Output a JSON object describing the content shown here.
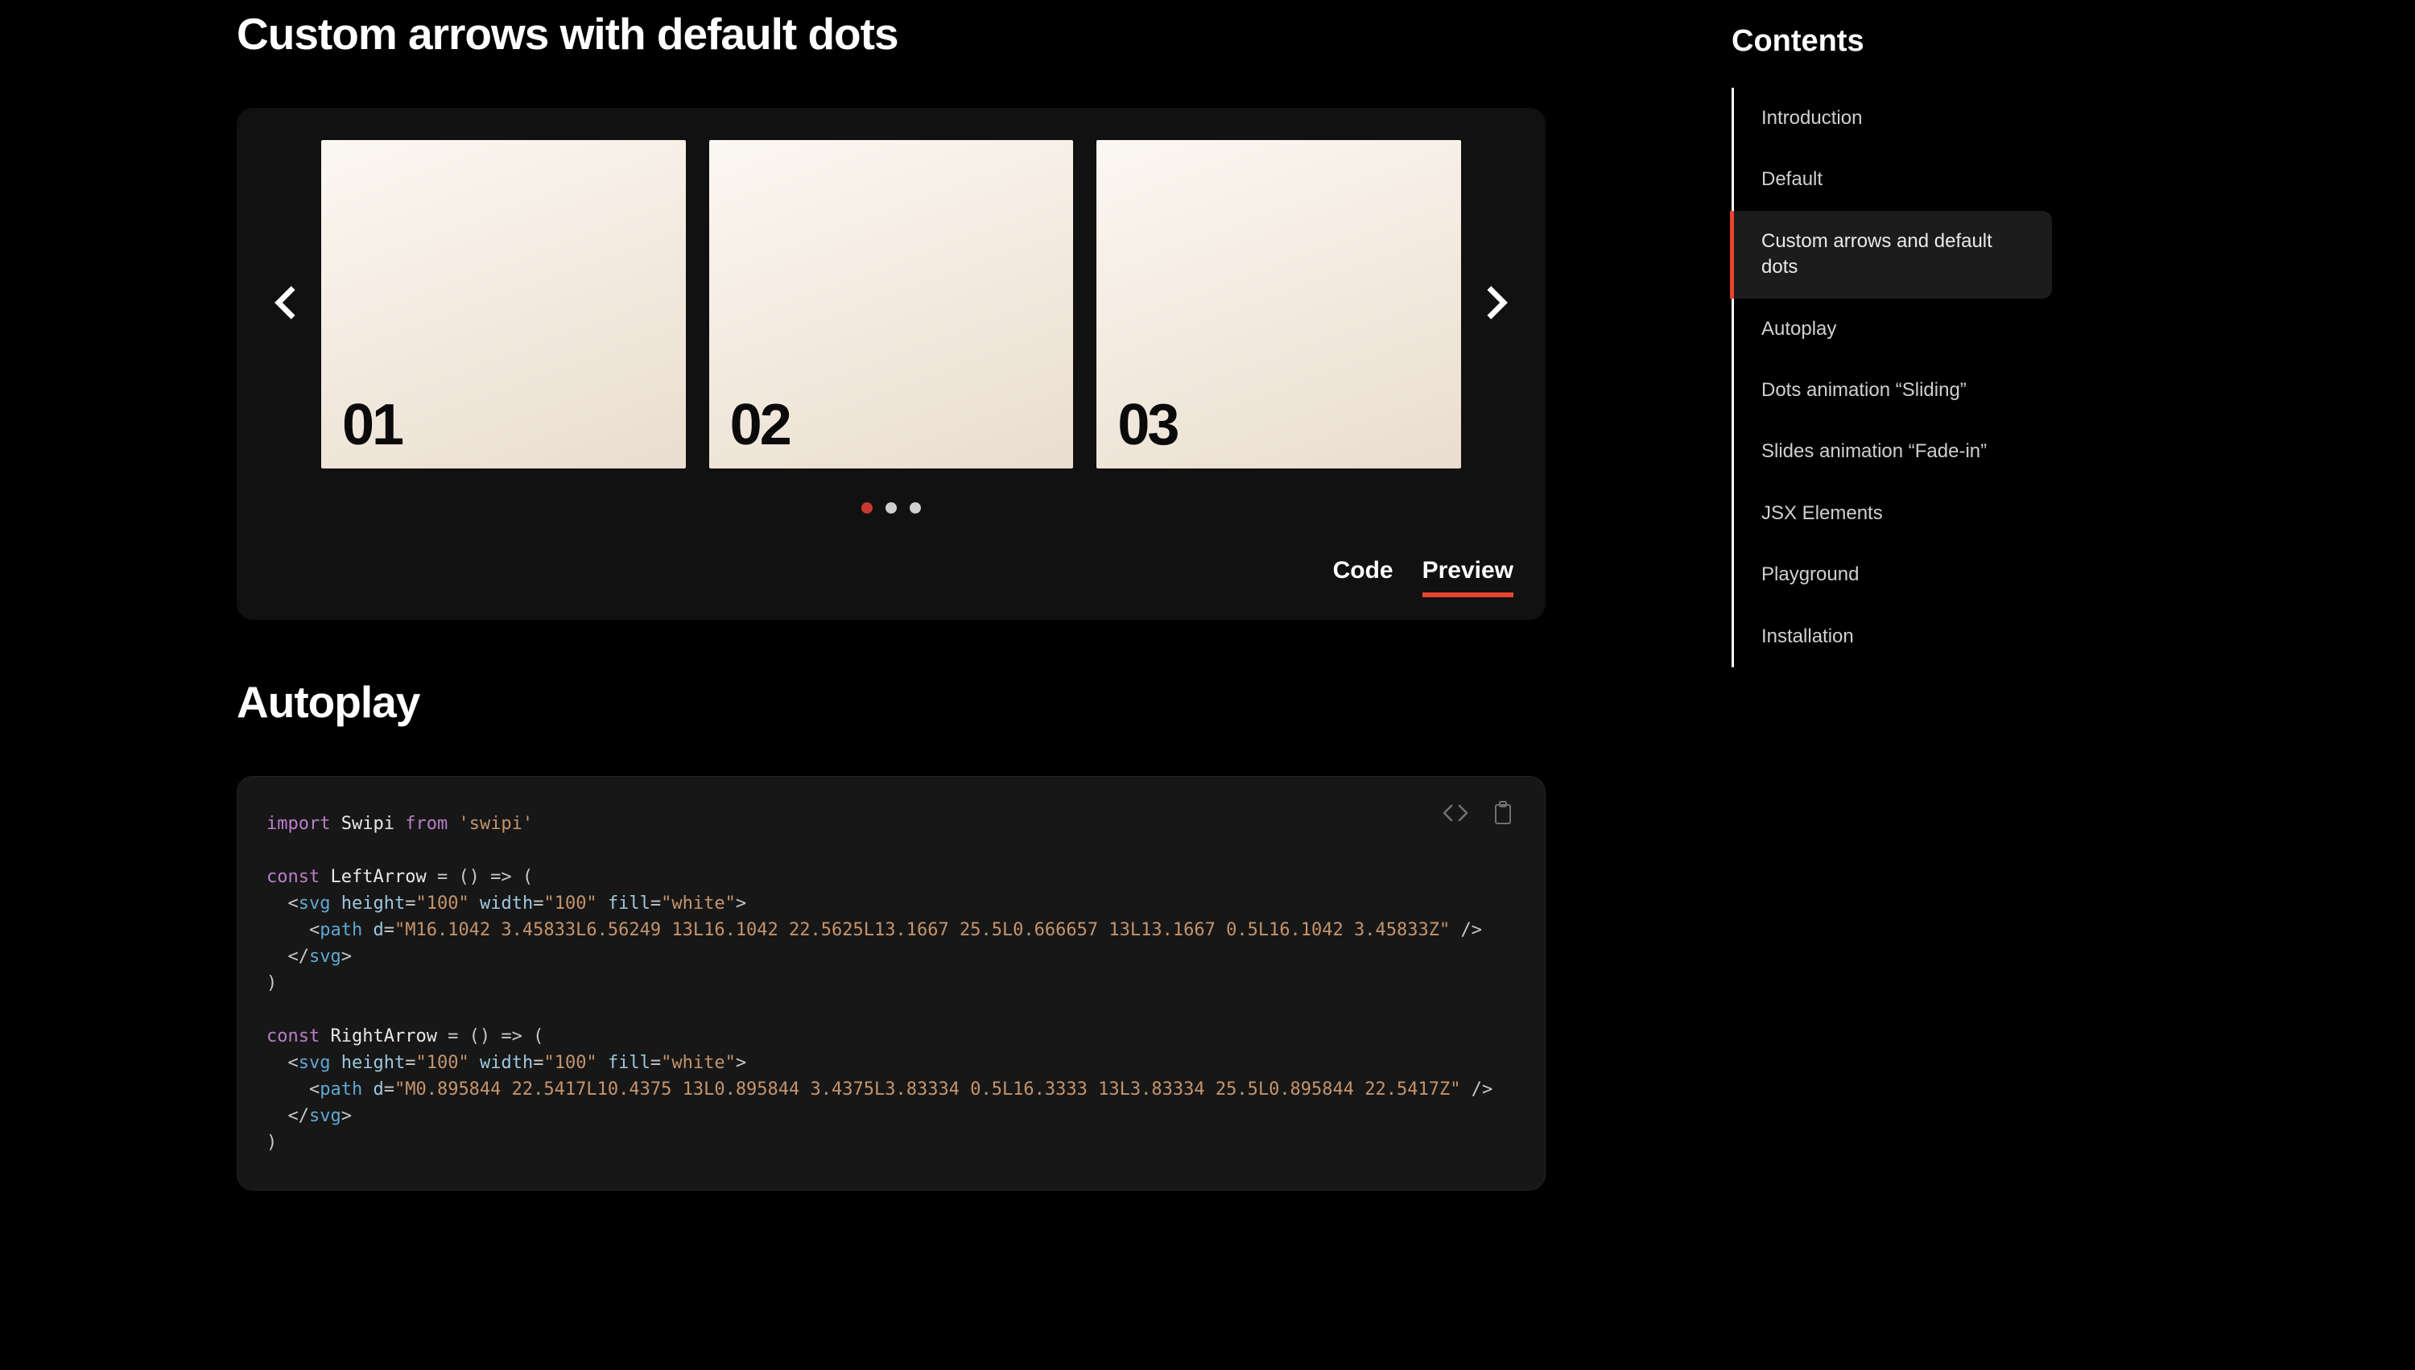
{
  "sections": {
    "custom_arrows": {
      "title": "Custom arrows with default dots",
      "slides": [
        "01",
        "02",
        "03"
      ],
      "active_dot": 0,
      "dot_count": 3,
      "tabs": {
        "code": "Code",
        "preview": "Preview",
        "active": "preview"
      }
    },
    "autoplay": {
      "title": "Autoplay",
      "code_tokens": [
        [
          "kw",
          "import"
        ],
        [
          "pun",
          " "
        ],
        [
          "id",
          "Swipi"
        ],
        [
          "pun",
          " "
        ],
        [
          "kw",
          "from"
        ],
        [
          "pun",
          " "
        ],
        [
          "str",
          "'swipi'"
        ],
        [
          "nl",
          ""
        ],
        [
          "nl",
          ""
        ],
        [
          "kw",
          "const"
        ],
        [
          "pun",
          " "
        ],
        [
          "id",
          "LeftArrow"
        ],
        [
          "pun",
          " = () => ("
        ],
        [
          "nl",
          ""
        ],
        [
          "pun",
          "  <"
        ],
        [
          "tag",
          "svg"
        ],
        [
          "pun",
          " "
        ],
        [
          "attr",
          "height"
        ],
        [
          "pun",
          "="
        ],
        [
          "str",
          "\"100\""
        ],
        [
          "pun",
          " "
        ],
        [
          "attr",
          "width"
        ],
        [
          "pun",
          "="
        ],
        [
          "str",
          "\"100\""
        ],
        [
          "pun",
          " "
        ],
        [
          "attr",
          "fill"
        ],
        [
          "pun",
          "="
        ],
        [
          "str",
          "\"white\""
        ],
        [
          "pun",
          ">"
        ],
        [
          "nl",
          ""
        ],
        [
          "pun",
          "    <"
        ],
        [
          "tag",
          "path"
        ],
        [
          "pun",
          " "
        ],
        [
          "attr",
          "d"
        ],
        [
          "pun",
          "="
        ],
        [
          "str",
          "\"M16.1042 3.45833L6.56249 13L16.1042 22.5625L13.1667 25.5L0.666657 13L13.1667 0.5L16.1042 3.45833Z\""
        ],
        [
          "pun",
          " />"
        ],
        [
          "nl",
          ""
        ],
        [
          "pun",
          "  </"
        ],
        [
          "tag",
          "svg"
        ],
        [
          "pun",
          ">"
        ],
        [
          "nl",
          ""
        ],
        [
          "pun",
          ")"
        ],
        [
          "nl",
          ""
        ],
        [
          "nl",
          ""
        ],
        [
          "kw",
          "const"
        ],
        [
          "pun",
          " "
        ],
        [
          "id",
          "RightArrow"
        ],
        [
          "pun",
          " = () => ("
        ],
        [
          "nl",
          ""
        ],
        [
          "pun",
          "  <"
        ],
        [
          "tag",
          "svg"
        ],
        [
          "pun",
          " "
        ],
        [
          "attr",
          "height"
        ],
        [
          "pun",
          "="
        ],
        [
          "str",
          "\"100\""
        ],
        [
          "pun",
          " "
        ],
        [
          "attr",
          "width"
        ],
        [
          "pun",
          "="
        ],
        [
          "str",
          "\"100\""
        ],
        [
          "pun",
          " "
        ],
        [
          "attr",
          "fill"
        ],
        [
          "pun",
          "="
        ],
        [
          "str",
          "\"white\""
        ],
        [
          "pun",
          ">"
        ],
        [
          "nl",
          ""
        ],
        [
          "pun",
          "    <"
        ],
        [
          "tag",
          "path"
        ],
        [
          "pun",
          " "
        ],
        [
          "attr",
          "d"
        ],
        [
          "pun",
          "="
        ],
        [
          "str",
          "\"M0.895844 22.5417L10.4375 13L0.895844 3.4375L3.83334 0.5L16.3333 13L3.83334 25.5L0.895844 22.5417Z\""
        ],
        [
          "pun",
          " />"
        ],
        [
          "nl",
          ""
        ],
        [
          "pun",
          "  </"
        ],
        [
          "tag",
          "svg"
        ],
        [
          "pun",
          ">"
        ],
        [
          "nl",
          ""
        ],
        [
          "pun",
          ")"
        ]
      ]
    }
  },
  "toc": {
    "title": "Contents",
    "items": [
      "Introduction",
      "Default",
      "Custom arrows and default dots",
      "Autoplay",
      "Dots animation “Sliding”",
      "Slides animation “Fade-in”",
      "JSX Elements",
      "Playground",
      "Installation"
    ],
    "active_index": 2
  }
}
